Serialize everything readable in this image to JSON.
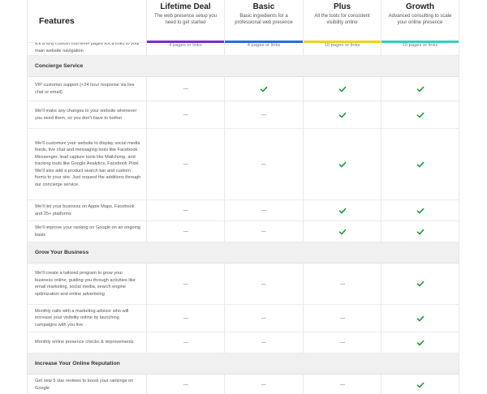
{
  "header": {
    "features_label": "Features",
    "plans": [
      {
        "name": "Lifetime Deal",
        "desc": "The web presence setup you need to get started",
        "bar_color": "#7b2cc6"
      },
      {
        "name": "Basic",
        "desc": "Basic ingredients for a professional web presence",
        "bar_color": "#1e6fe0"
      },
      {
        "name": "Plus",
        "desc": "All the tools for consistent visibility online",
        "bar_color": "#f2d21a"
      },
      {
        "name": "Growth",
        "desc": "Advanced consulting to scale your online presence",
        "bar_color": "#2fd0c0"
      }
    ]
  },
  "top_row": {
    "feature": "a.k.a fully custom first-level pages a.k.a links to your main website navigation",
    "values": [
      "4 pages or links",
      "4 pages or links",
      "10 pages or links",
      "10 pages or links"
    ]
  },
  "sections": [
    {
      "title": "Concierge Service",
      "rows": [
        {
          "text": "VIP customer support (<24 hour response via live chat or email)",
          "cells": [
            "dash",
            "check",
            "check",
            "check"
          ]
        },
        {
          "text": "We'll make any changes to your website whenever you need them, so you don't have to bother",
          "cells": [
            "dash",
            "dash",
            "check",
            "check"
          ]
        },
        {
          "text": "We'll customize your website to display social media feeds, live chat and messaging tools like Facebook Messenger, lead capture tools like Mailchimp, and tracking tools like Google Analytics, Facebook Pixel. We'll also add a product search bar and custom forms to your site. Just request the additions through our concierge service.",
          "cells": [
            "dash",
            "dash",
            "check",
            "check"
          ]
        },
        {
          "text": "We'll list your business on Apple Maps, Facebook and 25+ platforms",
          "cells": [
            "dash",
            "dash",
            "check",
            "check"
          ]
        },
        {
          "text": "We'll improve your ranking on Google on an ongoing basis",
          "cells": [
            "dash",
            "dash",
            "check",
            "check"
          ]
        }
      ]
    },
    {
      "title": "Grow Your Business",
      "rows": [
        {
          "text": "We'll create a tailored program to grow your business online, guiding you through activities like email marketing, social media, search engine optimization and online advertising",
          "cells": [
            "dash",
            "dash",
            "dash",
            "check"
          ]
        },
        {
          "text": "Monthly calls with a marketing advisor who will increase your visibility online by launching campaigns with you live",
          "cells": [
            "dash",
            "dash",
            "dash",
            "check"
          ]
        },
        {
          "text": "Monthly online presence checks & improvements",
          "cells": [
            "dash",
            "dash",
            "dash",
            "check"
          ]
        }
      ]
    },
    {
      "title": "Increase Your Online Reputation",
      "rows": [
        {
          "text": "Get new 5 star reviews to boost your rankings on Google",
          "cells": [
            "dash",
            "dash",
            "dash",
            "check"
          ]
        }
      ]
    }
  ],
  "icons": {
    "check": "check-icon",
    "dash": "dash-icon"
  },
  "colors": {
    "check": "#1e9a3a",
    "section_bg": "#f0f0f0"
  }
}
